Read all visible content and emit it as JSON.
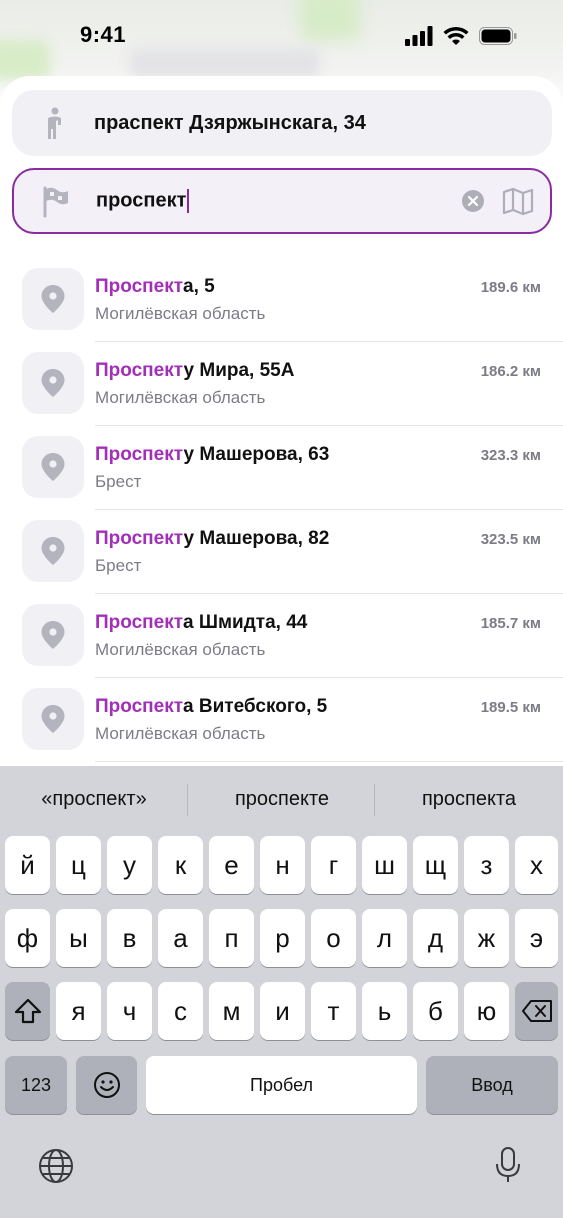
{
  "status_bar": {
    "time": "9:41"
  },
  "route": {
    "from_value": "праспект Дзяржынскага, 34",
    "to_value": "проспект"
  },
  "results": [
    {
      "highlight": "Проспект",
      "rest": "а, 5",
      "region": "Могилёвская область",
      "distance": "189.6 км"
    },
    {
      "highlight": "Проспект",
      "rest": "у Мира, 55А",
      "region": "Могилёвская область",
      "distance": "186.2 км"
    },
    {
      "highlight": "Проспект",
      "rest": "у Машерова, 63",
      "region": "Брест",
      "distance": "323.3 км"
    },
    {
      "highlight": "Проспект",
      "rest": "у Машерова, 82",
      "region": "Брест",
      "distance": "323.5 км"
    },
    {
      "highlight": "Проспект",
      "rest": "а Шмидта, 44",
      "region": "Могилёвская область",
      "distance": "185.7 км"
    },
    {
      "highlight": "Проспект",
      "rest": "а Витебского, 5",
      "region": "Могилёвская область",
      "distance": "189.5 км"
    }
  ],
  "keyboard": {
    "suggestions": [
      "«проспект»",
      "проспекте",
      "проспекта"
    ],
    "row1": [
      "й",
      "ц",
      "у",
      "к",
      "е",
      "н",
      "г",
      "ш",
      "щ",
      "з",
      "х"
    ],
    "row2": [
      "ф",
      "ы",
      "в",
      "а",
      "п",
      "р",
      "о",
      "л",
      "д",
      "ж",
      "э"
    ],
    "row3": [
      "я",
      "ч",
      "с",
      "м",
      "и",
      "т",
      "ь",
      "б",
      "ю"
    ],
    "numbers_key": "123",
    "space_key": "Пробел",
    "return_key": "Ввод"
  },
  "colors": {
    "accent": "#a22fb8",
    "field_border": "#8a2ca0",
    "secondary_text": "#7c7c86"
  },
  "icons": [
    "walking-person-icon",
    "flag-icon",
    "clear-icon",
    "map-icon",
    "location-pin-icon",
    "shift-icon",
    "backspace-icon",
    "emoji-icon",
    "globe-icon",
    "microphone-icon"
  ]
}
